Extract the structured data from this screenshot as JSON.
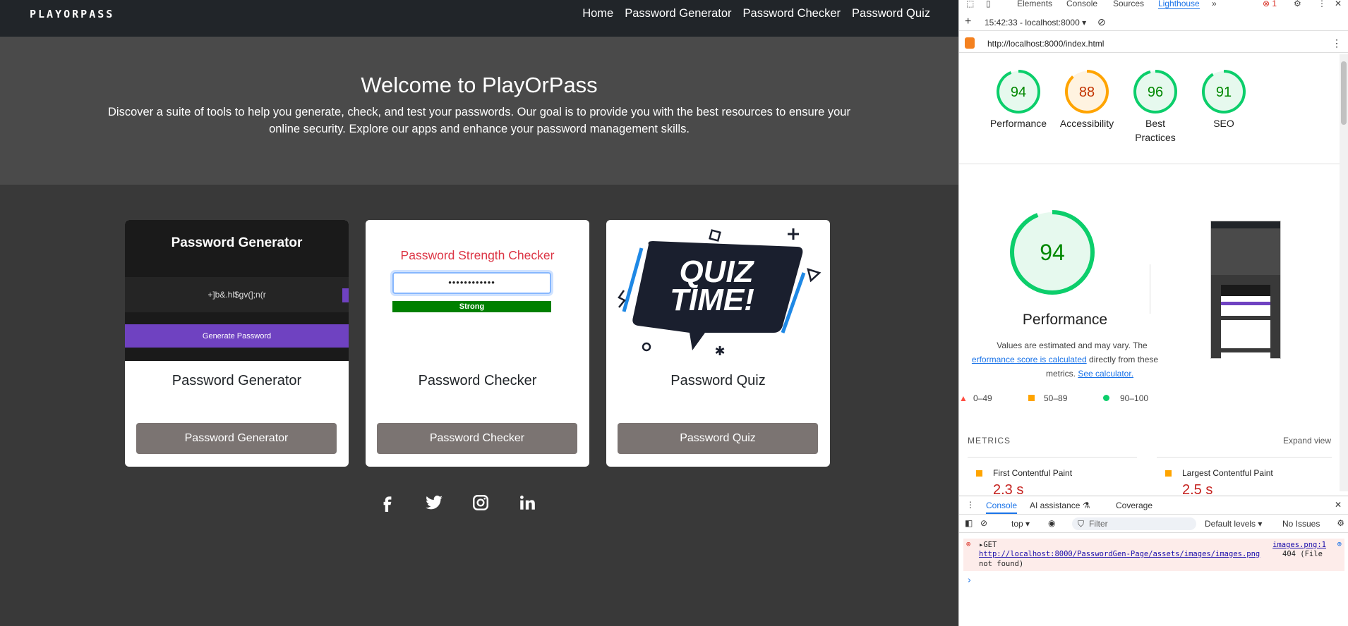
{
  "site": {
    "logo": "PLAYORPASS",
    "nav": [
      "Home",
      "Password Generator",
      "Password Checker",
      "Password Quiz"
    ],
    "hero": {
      "title": "Welcome to PlayOrPass",
      "text": "Discover a suite of tools to help you generate, check, and test your passwords. Our goal is to provide you with the best resources to ensure your online security. Explore our apps and enhance your password management skills."
    },
    "cards": [
      {
        "title": "Password Generator",
        "button": "Password Generator",
        "thumb_title": "Password Generator",
        "thumb_password": "+]b&.hl$gv(];n(r",
        "thumb_button": "Generate Password"
      },
      {
        "title": "Password Checker",
        "button": "Password Checker",
        "thumb_title": "Password Strength Checker",
        "thumb_input": "••••••••••••",
        "thumb_status": "Strong"
      },
      {
        "title": "Password Quiz",
        "button": "Password Quiz",
        "thumb_text_1": "QUIZ",
        "thumb_text_2": "TIME!"
      }
    ],
    "socials": [
      "facebook-icon",
      "twitter-icon",
      "instagram-icon",
      "linkedin-icon"
    ],
    "colors": {
      "navbar": "#212529",
      "hero": "#4a4a4a",
      "body": "#393939",
      "card_button": "#7b7472",
      "purple": "#6f42c1"
    }
  },
  "devtools": {
    "tabs": [
      "Elements",
      "Console",
      "Sources",
      "Lighthouse"
    ],
    "active_tab": "Lighthouse",
    "error_count": "1",
    "report_selector": "15:42:33 - localhost:8000",
    "url": "http://localhost:8000/index.html",
    "scores": [
      {
        "label": "Performance",
        "value": 94,
        "color": "#0cce6b"
      },
      {
        "label": "Accessibility",
        "value": 88,
        "color": "#ffa400"
      },
      {
        "label": "Best Practices",
        "value": 96,
        "color": "#0cce6b"
      },
      {
        "label": "SEO",
        "value": 91,
        "color": "#0cce6b"
      }
    ],
    "perf_score": "94",
    "perf_title": "Performance",
    "perf_desc_1": "Values are estimated and may vary. The",
    "perf_desc_link": "erformance score is calculated",
    "perf_desc_2": "directly from these",
    "perf_desc_3": "metrics.",
    "perf_desc_link2": "See calculator.",
    "legend": [
      "0–49",
      "50–89",
      "90–100"
    ],
    "metrics_heading": "METRICS",
    "expand_view": "Expand view",
    "metrics": [
      {
        "name": "First Contentful Paint",
        "value": "2.3 s"
      },
      {
        "name": "Largest Contentful Paint",
        "value": "2.5 s"
      }
    ],
    "drawer_tabs": [
      "Console",
      "AI assistance",
      "Coverage"
    ],
    "context": "top",
    "filter_placeholder": "Filter",
    "levels": "Default levels",
    "issues": "No Issues",
    "error": {
      "method": "GET",
      "source": "images.png:1",
      "url": "http://localhost:8000/PasswordGen-Page/assets/images/images.png",
      "status": "404 (File",
      "status_2": "not found)"
    },
    "prompt": "›"
  }
}
